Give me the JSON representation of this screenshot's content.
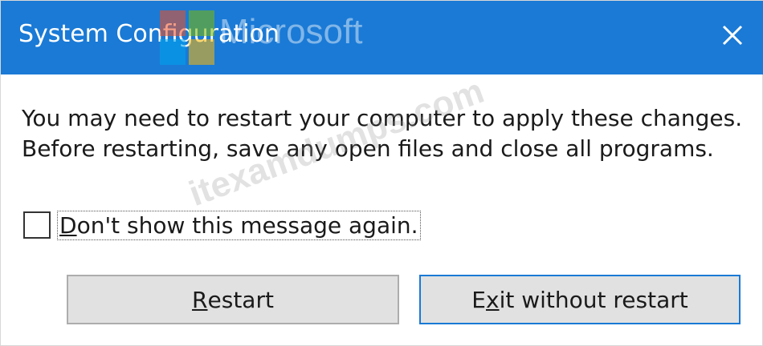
{
  "window": {
    "title": "System Configuration",
    "close_icon": "close-icon",
    "titlebar_color": "#1a7ad6"
  },
  "message": {
    "line1": "You may need to restart your computer to apply these changes.",
    "line2": "Before restarting, save any open files and close all programs."
  },
  "checkbox": {
    "label_prefix": "",
    "label_mnemonic": "D",
    "label_rest": "on't show this message again.",
    "checked": false
  },
  "buttons": {
    "restart_mnemonic": "R",
    "restart_rest": "estart",
    "exit_prefix": "E",
    "exit_mnemonic": "x",
    "exit_rest": "it without restart"
  },
  "watermark": {
    "brand": "Microsoft",
    "site": "itexamdumps.com"
  }
}
